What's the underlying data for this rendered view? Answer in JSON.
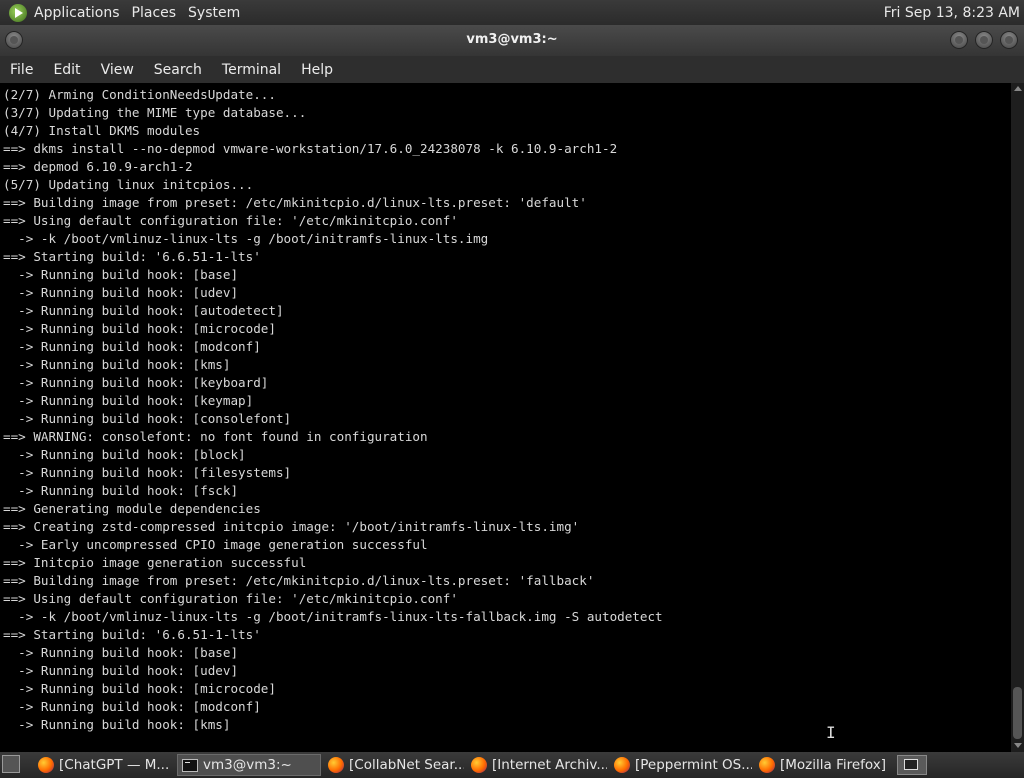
{
  "top_panel": {
    "menus": [
      "Applications",
      "Places",
      "System"
    ],
    "clock": "Fri Sep 13,  8:23 AM"
  },
  "window": {
    "title": "vm3@vm3:~"
  },
  "menubar": {
    "items": [
      "File",
      "Edit",
      "View",
      "Search",
      "Terminal",
      "Help"
    ]
  },
  "terminal": {
    "lines": [
      "(2/7) Arming ConditionNeedsUpdate...",
      "(3/7) Updating the MIME type database...",
      "(4/7) Install DKMS modules",
      "==> dkms install --no-depmod vmware-workstation/17.6.0_24238078 -k 6.10.9-arch1-2",
      "==> depmod 6.10.9-arch1-2",
      "(5/7) Updating linux initcpios...",
      "==> Building image from preset: /etc/mkinitcpio.d/linux-lts.preset: 'default'",
      "==> Using default configuration file: '/etc/mkinitcpio.conf'",
      "  -> -k /boot/vmlinuz-linux-lts -g /boot/initramfs-linux-lts.img",
      "==> Starting build: '6.6.51-1-lts'",
      "  -> Running build hook: [base]",
      "  -> Running build hook: [udev]",
      "  -> Running build hook: [autodetect]",
      "  -> Running build hook: [microcode]",
      "  -> Running build hook: [modconf]",
      "  -> Running build hook: [kms]",
      "  -> Running build hook: [keyboard]",
      "  -> Running build hook: [keymap]",
      "  -> Running build hook: [consolefont]",
      "==> WARNING: consolefont: no font found in configuration",
      "  -> Running build hook: [block]",
      "  -> Running build hook: [filesystems]",
      "  -> Running build hook: [fsck]",
      "==> Generating module dependencies",
      "==> Creating zstd-compressed initcpio image: '/boot/initramfs-linux-lts.img'",
      "  -> Early uncompressed CPIO image generation successful",
      "==> Initcpio image generation successful",
      "==> Building image from preset: /etc/mkinitcpio.d/linux-lts.preset: 'fallback'",
      "==> Using default configuration file: '/etc/mkinitcpio.conf'",
      "  -> -k /boot/vmlinuz-linux-lts -g /boot/initramfs-linux-lts-fallback.img -S autodetect",
      "==> Starting build: '6.6.51-1-lts'",
      "  -> Running build hook: [base]",
      "  -> Running build hook: [udev]",
      "  -> Running build hook: [microcode]",
      "  -> Running build hook: [modconf]",
      "  -> Running build hook: [kms]"
    ]
  },
  "taskbar": {
    "tasks": [
      {
        "label": "[ChatGPT — M...",
        "icon": "firefox-icon"
      },
      {
        "label": "vm3@vm3:~",
        "icon": "terminal-icon",
        "active": true
      },
      {
        "label": "[CollabNet Sear...",
        "icon": "firefox-icon"
      },
      {
        "label": "[Internet Archiv...",
        "icon": "firefox-icon"
      },
      {
        "label": "[Peppermint OS...",
        "icon": "firefox-icon"
      },
      {
        "label": "[Mozilla Firefox]",
        "icon": "firefox-icon"
      }
    ]
  }
}
